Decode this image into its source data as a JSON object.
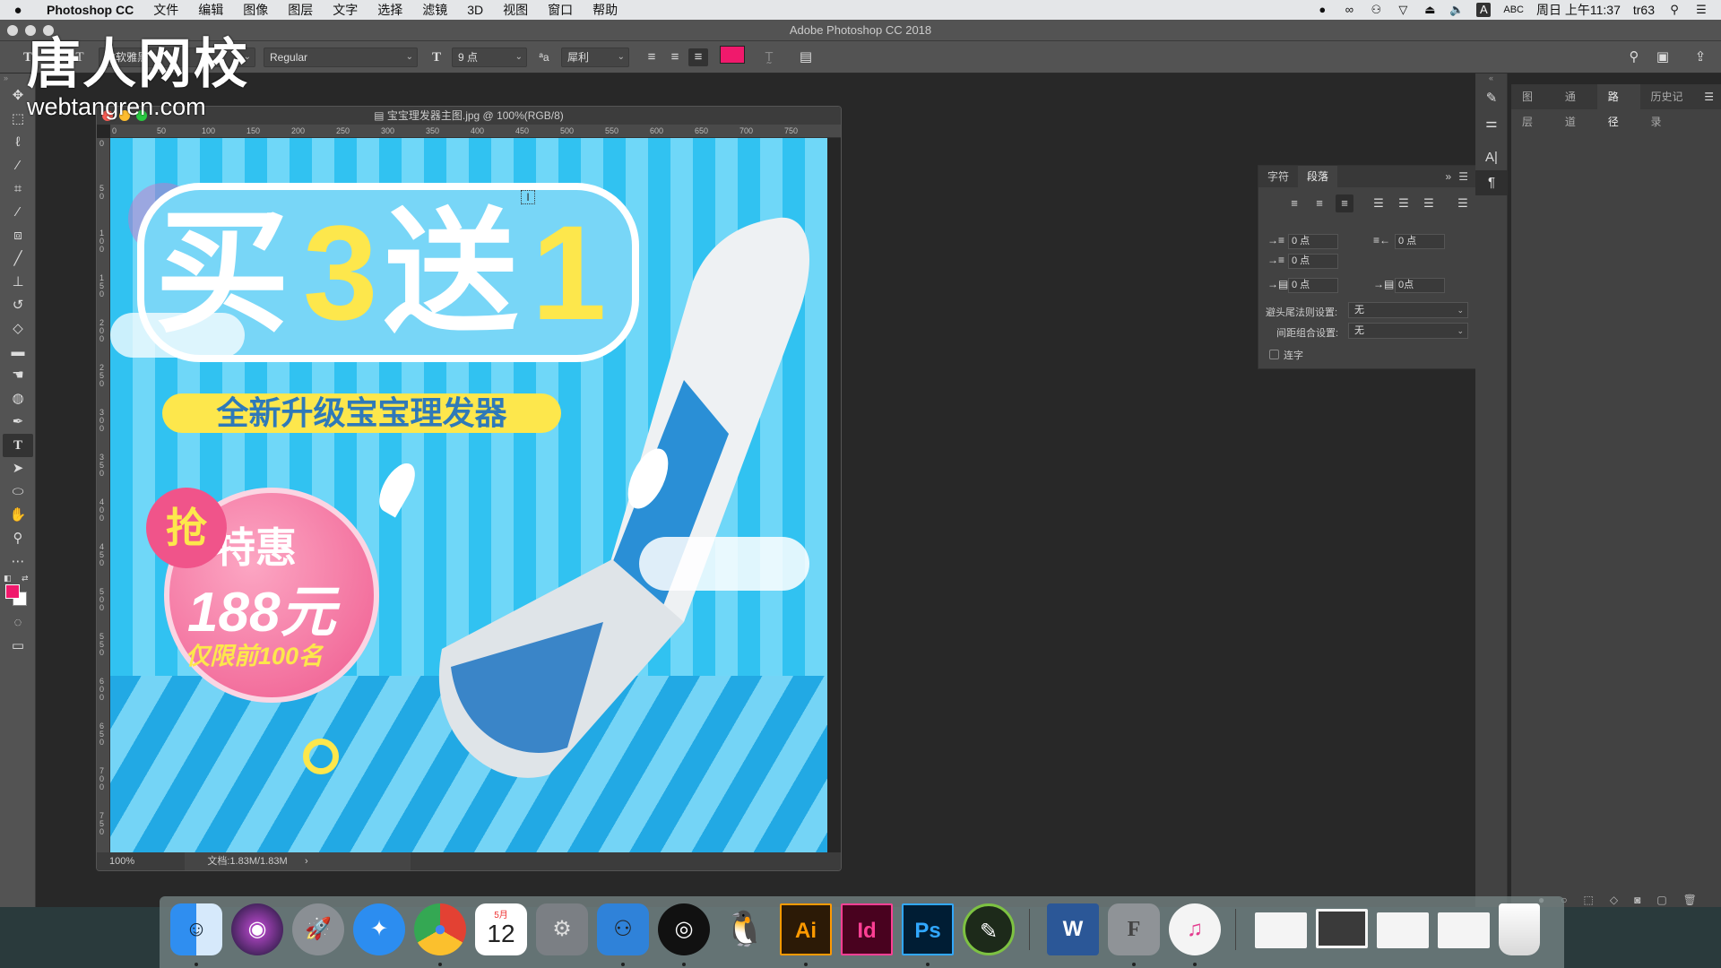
{
  "menubar": {
    "app_name": "Photoshop CC",
    "items": [
      "文件",
      "编辑",
      "图像",
      "图层",
      "文字",
      "选择",
      "滤镜",
      "3D",
      "视图",
      "窗口",
      "帮助"
    ],
    "status_icons": [
      "obs-icon",
      "creative-cloud-icon",
      "binoculars-icon",
      "wifi-icon",
      "eject-icon",
      "volume-icon"
    ],
    "input_method": "ABC",
    "clock": "周日 上午11:37",
    "user": "tr63"
  },
  "window": {
    "title": "Adobe Photoshop CC 2018"
  },
  "options_bar": {
    "font_family": "微软雅黑",
    "font_style": "Regular",
    "font_size": "9 点",
    "antialias": "犀利",
    "text_color": "#f0196c"
  },
  "tools": [
    "move",
    "marquee",
    "lasso",
    "magic-wand",
    "crop",
    "eyedropper",
    "healing",
    "brush",
    "stamp",
    "history-brush",
    "eraser",
    "gradient",
    "blur",
    "dodge",
    "pen",
    "type",
    "path-select",
    "ellipse",
    "hand",
    "zoom",
    "more"
  ],
  "active_tool": "type",
  "colors": {
    "foreground": "#f0196c",
    "background": "#ffffff"
  },
  "document": {
    "title": "宝宝理发器主图.jpg @ 100%(RGB/8)",
    "zoom": "100%",
    "doc_size": "文档:1.83M/1.83M",
    "ruler_ticks": [
      "0",
      "50",
      "100",
      "150",
      "200",
      "250",
      "300",
      "350",
      "400",
      "450",
      "500",
      "550",
      "600",
      "650",
      "700",
      "750"
    ]
  },
  "artwork": {
    "headline": [
      "买",
      "3",
      "送",
      "1"
    ],
    "subtitle": "全新升级宝宝理发器",
    "burst": "抢",
    "promo": "特惠",
    "price": "188元",
    "limit": "仅限前100名"
  },
  "right_panel": {
    "tabs": [
      "图层",
      "通道",
      "路径",
      "历史记录"
    ],
    "active_tab": "路径"
  },
  "paragraph_panel": {
    "tabs": [
      "字符",
      "段落"
    ],
    "active_tab": "段落",
    "left_indent": "0 点",
    "right_indent": "0 点",
    "first_line_indent": "0 点",
    "space_before": "0 点",
    "space_after": "0点",
    "kinsoku_label": "避头尾法则设置:",
    "kinsoku_value": "无",
    "mojikumi_label": "间距组合设置:",
    "mojikumi_value": "无",
    "hyphenate_label": "连字",
    "hyphenate_checked": false
  },
  "watermark": {
    "name": "唐人网校",
    "url": "webtangren.com"
  },
  "dock": [
    "Finder",
    "Siri",
    "Launchpad",
    "Safari",
    "Chrome",
    "日历",
    "系统偏好设置",
    "Preview",
    "OBS",
    "QQ",
    "Ai",
    "Id",
    "Ps",
    "Sketchbook",
    "Word",
    "Font Book",
    "iTunes",
    "窗口1",
    "窗口2",
    "窗口3",
    "窗口4",
    "废纸篓"
  ],
  "calendar": {
    "month": "5月",
    "day": "12"
  }
}
